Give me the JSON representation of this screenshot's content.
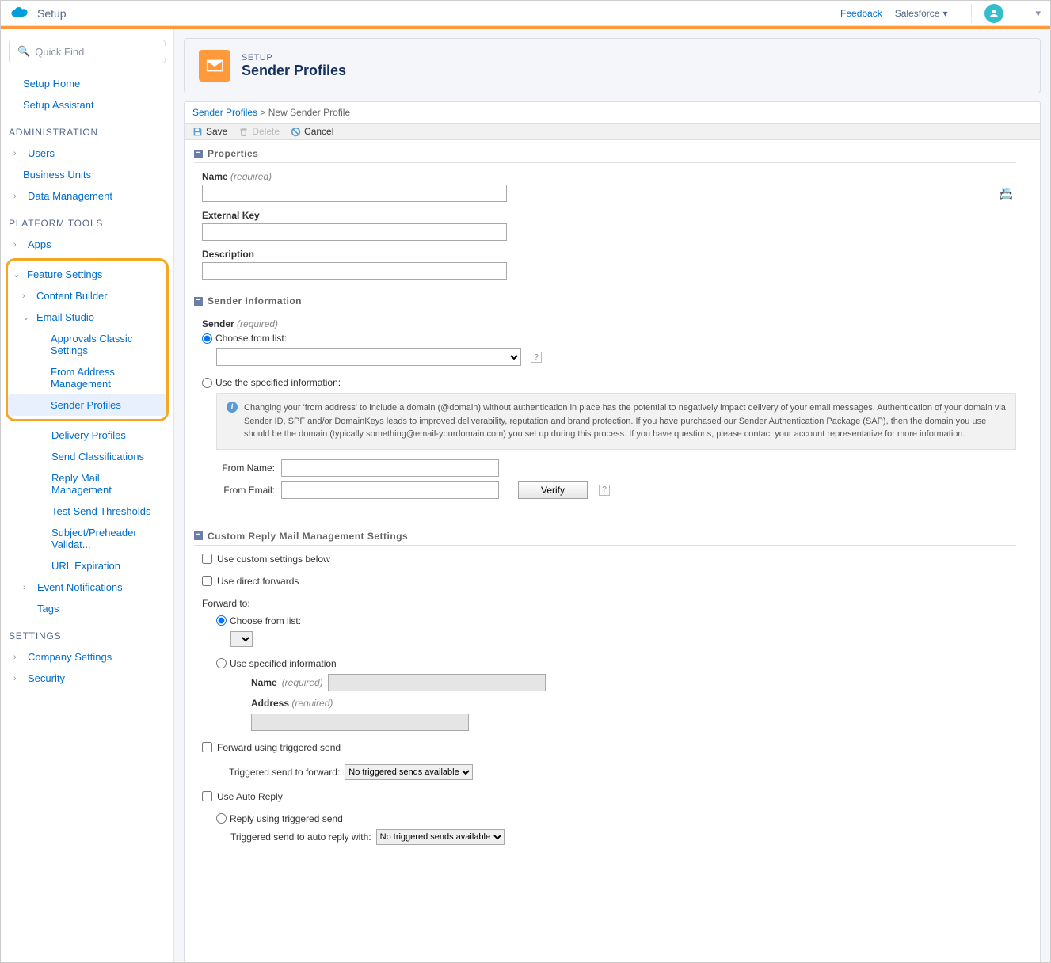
{
  "topbar": {
    "app_title": "Setup",
    "feedback": "Feedback",
    "org_name": "Salesforce"
  },
  "quickfind": {
    "placeholder": "Quick Find"
  },
  "nav": {
    "setup_home": "Setup Home",
    "setup_assistant": "Setup Assistant",
    "section_admin": "ADMINISTRATION",
    "users": "Users",
    "business_units": "Business Units",
    "data_management": "Data Management",
    "section_platform": "PLATFORM TOOLS",
    "apps": "Apps",
    "feature_settings": "Feature Settings",
    "content_builder": "Content Builder",
    "email_studio": "Email Studio",
    "approvals": "Approvals Classic Settings",
    "from_address": "From Address Management",
    "sender_profiles": "Sender Profiles",
    "delivery_profiles": "Delivery Profiles",
    "send_classifications": "Send Classifications",
    "reply_mail": "Reply Mail Management",
    "test_send": "Test Send Thresholds",
    "subject_preheader": "Subject/Preheader Validat...",
    "url_expiration": "URL Expiration",
    "event_notifications": "Event Notifications",
    "tags": "Tags",
    "section_settings": "SETTINGS",
    "company_settings": "Company Settings",
    "security": "Security"
  },
  "header": {
    "eyebrow": "SETUP",
    "title": "Sender Profiles"
  },
  "breadcrumb": {
    "parent": "Sender Profiles",
    "sep": ">",
    "current": "New Sender Profile"
  },
  "actions": {
    "save": "Save",
    "delete": "Delete",
    "cancel": "Cancel"
  },
  "sections": {
    "properties": "Properties",
    "sender_info": "Sender Information",
    "custom_reply": "Custom Reply Mail Management Settings"
  },
  "form": {
    "name_label": "Name",
    "required": "(required)",
    "external_key": "External Key",
    "description": "Description",
    "sender_label": "Sender",
    "choose_from_list": "Choose from list:",
    "use_specified": "Use the specified information:",
    "info_text": "Changing your 'from address' to include a domain (@domain) without authentication in place has the potential to negatively impact delivery of your email messages. Authentication of your domain via Sender ID, SPF and/or DomainKeys leads to improved deliverability, reputation and brand protection. If you have purchased our Sender Authentication Package (SAP), then the domain you use should be the domain (typically something@email-yourdomain.com) you set up during this process. If you have questions, please contact your account representative for more information.",
    "from_name": "From Name:",
    "from_email": "From Email:",
    "verify_btn": "Verify",
    "use_custom_settings": "Use custom settings below",
    "use_direct_forwards": "Use direct forwards",
    "forward_to": "Forward to:",
    "use_specified_info": "Use specified information",
    "fwd_name": "Name",
    "fwd_address": "Address",
    "forward_triggered": "Forward using triggered send",
    "triggered_fwd_label": "Triggered send to forward:",
    "no_triggered": "No triggered sends available",
    "use_auto_reply": "Use Auto Reply",
    "reply_triggered": "Reply using triggered send",
    "triggered_reply_label": "Triggered send to auto reply with:"
  }
}
